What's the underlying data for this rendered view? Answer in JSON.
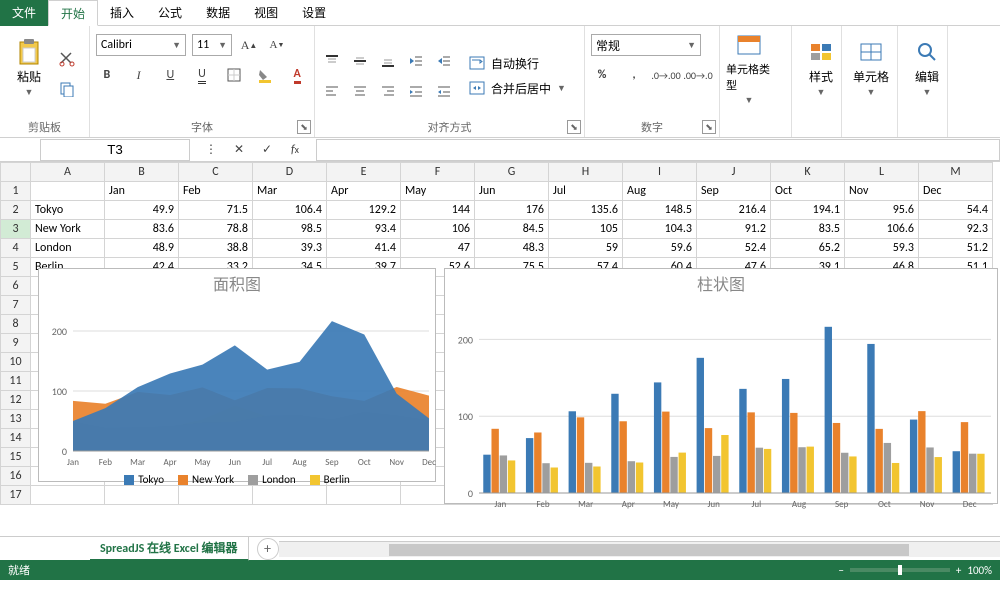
{
  "tabs": {
    "file": "文件",
    "items": [
      "开始",
      "插入",
      "公式",
      "数据",
      "视图",
      "设置"
    ],
    "active": 0
  },
  "ribbon": {
    "clipboard": {
      "label": "剪贴板",
      "paste": "粘贴"
    },
    "font": {
      "label": "字体",
      "name": "Calibri",
      "size": "11"
    },
    "align": {
      "label": "对齐方式",
      "wrap": "自动换行",
      "merge": "合并后居中"
    },
    "number": {
      "label": "数字",
      "format": "常规"
    },
    "celltype": {
      "label": "单元格类型"
    },
    "styles": {
      "label": "样式"
    },
    "cells": {
      "label": "单元格"
    },
    "edit": {
      "label": "编辑"
    }
  },
  "formula": {
    "cell": "T3"
  },
  "columns": [
    "A",
    "B",
    "C",
    "D",
    "E",
    "F",
    "G",
    "H",
    "I",
    "J",
    "K",
    "L",
    "M"
  ],
  "rows": [
    {
      "h": "1",
      "cells": [
        "",
        "Jan",
        "Feb",
        "Mar",
        "Apr",
        "May",
        "Jun",
        "Jul",
        "Aug",
        "Sep",
        "Oct",
        "Nov",
        "Dec"
      ]
    },
    {
      "h": "2",
      "cells": [
        "Tokyo",
        "49.9",
        "71.5",
        "106.4",
        "129.2",
        "144",
        "176",
        "135.6",
        "148.5",
        "216.4",
        "194.1",
        "95.6",
        "54.4"
      ]
    },
    {
      "h": "3",
      "cells": [
        "New York",
        "83.6",
        "78.8",
        "98.5",
        "93.4",
        "106",
        "84.5",
        "105",
        "104.3",
        "91.2",
        "83.5",
        "106.6",
        "92.3"
      ],
      "sel": true
    },
    {
      "h": "4",
      "cells": [
        "London",
        "48.9",
        "38.8",
        "39.3",
        "41.4",
        "47",
        "48.3",
        "59",
        "59.6",
        "52.4",
        "65.2",
        "59.3",
        "51.2"
      ]
    },
    {
      "h": "5",
      "cells": [
        "Berlin",
        "42.4",
        "33.2",
        "34.5",
        "39.7",
        "52.6",
        "75.5",
        "57.4",
        "60.4",
        "47.6",
        "39.1",
        "46.8",
        "51.1"
      ]
    },
    {
      "h": "6"
    },
    {
      "h": "7"
    },
    {
      "h": "8"
    },
    {
      "h": "9"
    },
    {
      "h": "10"
    },
    {
      "h": "11"
    },
    {
      "h": "12"
    },
    {
      "h": "13"
    },
    {
      "h": "14"
    },
    {
      "h": "15"
    },
    {
      "h": "16"
    },
    {
      "h": "17"
    }
  ],
  "chart_data": [
    {
      "type": "area",
      "title": "面积图",
      "categories": [
        "Jan",
        "Feb",
        "Mar",
        "Apr",
        "May",
        "Jun",
        "Jul",
        "Aug",
        "Sep",
        "Oct",
        "Nov",
        "Dec"
      ],
      "series": [
        {
          "name": "Tokyo",
          "values": [
            49.9,
            71.5,
            106.4,
            129.2,
            144,
            176,
            135.6,
            148.5,
            216.4,
            194.1,
            95.6,
            54.4
          ],
          "color": "#3b7ab5"
        },
        {
          "name": "New York",
          "values": [
            83.6,
            78.8,
            98.5,
            93.4,
            106,
            84.5,
            105,
            104.3,
            91.2,
            83.5,
            106.6,
            92.3
          ],
          "color": "#e9822c"
        },
        {
          "name": "London",
          "values": [
            48.9,
            38.8,
            39.3,
            41.4,
            47,
            48.3,
            59,
            59.6,
            52.4,
            65.2,
            59.3,
            51.2
          ],
          "color": "#9e9e9e"
        },
        {
          "name": "Berlin",
          "values": [
            42.4,
            33.2,
            34.5,
            39.7,
            52.6,
            75.5,
            57.4,
            60.4,
            47.6,
            39.1,
            46.8,
            51.1
          ],
          "color": "#f2c530"
        }
      ],
      "ylim": [
        0,
        250
      ],
      "yticks": [
        0,
        100,
        200
      ]
    },
    {
      "type": "bar",
      "title": "柱状图",
      "categories": [
        "Jan",
        "Feb",
        "Mar",
        "Apr",
        "May",
        "Jun",
        "Jul",
        "Aug",
        "Sep",
        "Oct",
        "Nov",
        "Dec"
      ],
      "series": [
        {
          "name": "Tokyo",
          "values": [
            49.9,
            71.5,
            106.4,
            129.2,
            144,
            176,
            135.6,
            148.5,
            216.4,
            194.1,
            95.6,
            54.4
          ],
          "color": "#3b7ab5"
        },
        {
          "name": "New York",
          "values": [
            83.6,
            78.8,
            98.5,
            93.4,
            106,
            84.5,
            105,
            104.3,
            91.2,
            83.5,
            106.6,
            92.3
          ],
          "color": "#e9822c"
        },
        {
          "name": "London",
          "values": [
            48.9,
            38.8,
            39.3,
            41.4,
            47,
            48.3,
            59,
            59.6,
            52.4,
            65.2,
            59.3,
            51.2
          ],
          "color": "#9e9e9e"
        },
        {
          "name": "Berlin",
          "values": [
            42.4,
            33.2,
            34.5,
            39.7,
            52.6,
            75.5,
            57.4,
            60.4,
            47.6,
            39.1,
            46.8,
            51.1
          ],
          "color": "#f2c530"
        }
      ],
      "ylim": [
        0,
        250
      ],
      "yticks": [
        0,
        100,
        200
      ]
    }
  ],
  "sheet_tabs": {
    "name": "SpreadJS 在线 Excel 编辑器"
  },
  "status": {
    "ready": "就绪",
    "zoom": "100%"
  }
}
